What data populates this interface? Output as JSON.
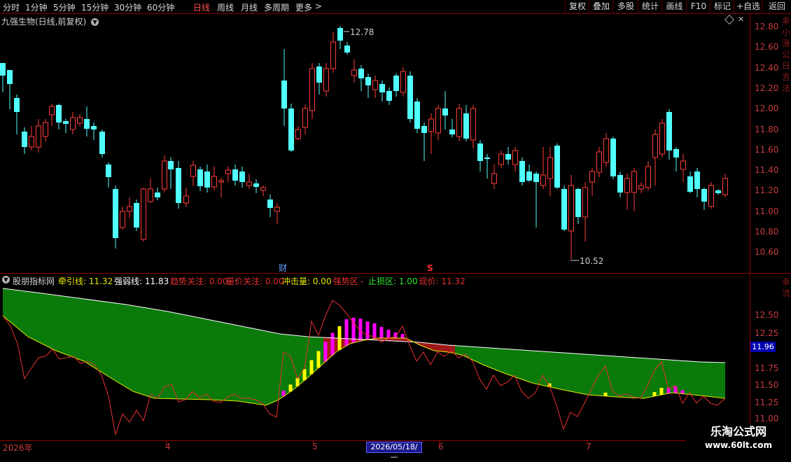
{
  "toolbar": {
    "periods": [
      "分时",
      "1分钟",
      "5分钟",
      "15分钟",
      "30分钟",
      "60分钟",
      "日线",
      "周线",
      "月线",
      "多周期",
      "更多"
    ],
    "active_period": "日线",
    "more_arrow": ">",
    "buttons": [
      "复权",
      "叠加",
      "多股",
      "统计",
      "画线",
      "F10",
      "标记",
      "+自选",
      "返回"
    ]
  },
  "main_chart": {
    "title": "九强生物(日线,前复权)",
    "high_label": "12.78",
    "low_label": "10.52",
    "marker_fin": "财",
    "marker_s": "S",
    "y_ticks": [
      "12.80",
      "12.60",
      "12.40",
      "12.20",
      "12.00",
      "11.80",
      "11.60",
      "11.40",
      "11.20",
      "11.00",
      "10.80",
      "10.60"
    ],
    "right_edge_text": "幸 小 涨 公 日 言 法"
  },
  "indicator": {
    "name": "股朋指标网",
    "items": [
      {
        "label": "牵引线: ",
        "value": "11.32",
        "color": "#e8e800"
      },
      {
        "label": "强弱线: ",
        "value": "11.83",
        "color": "#ffffff"
      },
      {
        "label": "趋势关注: ",
        "value": "0.00",
        "color": "#e83030"
      },
      {
        "label": "量价关注: ",
        "value": "0.00",
        "color": "#e83030"
      },
      {
        "label": "冲击量: ",
        "value": "0.00",
        "color": "#e8e800"
      },
      {
        "label": "强势区",
        "value": " - ",
        "color": "#e83030"
      },
      {
        "label": "止损区: ",
        "value": "1.00",
        "color": "#30e830"
      },
      {
        "label": "现价: ",
        "value": "11.32",
        "color": "#e83030"
      }
    ],
    "y_ticks": [
      "12.50",
      "12.25",
      "11.75",
      "11.50",
      "11.25",
      "11.00"
    ],
    "current_value": "11.96"
  },
  "time_axis": {
    "labels": [
      "2026年",
      "4",
      "5",
      "6",
      "7"
    ],
    "cursor_date": "2026/05/18/—"
  },
  "watermark": {
    "title": "乐淘公式网",
    "url": "www.60lt.com"
  },
  "colors": {
    "up": "#ff3c3c",
    "down": "#50ffff",
    "border": "#8c0000",
    "axis_text": "#c83c3c",
    "strong_fill": "#a01818",
    "stop_fill": "#0a7a0a",
    "traction_line": "#e8e800",
    "strength_line": "#ffffff",
    "price_line": "#e83030",
    "impact_bar": "#ff00ff",
    "impact_bar_alt": "#ffff00"
  }
}
